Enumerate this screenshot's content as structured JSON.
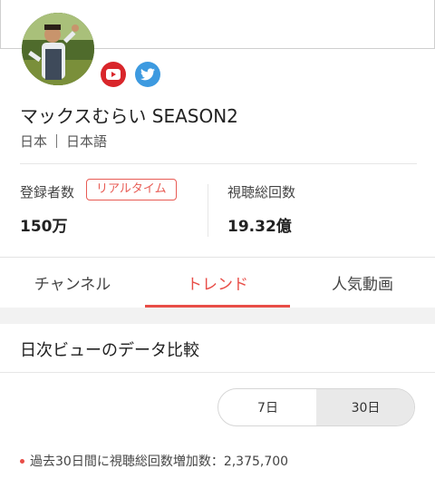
{
  "channel": {
    "name": "マックスむらい SEASON2",
    "country": "日本",
    "language": "日本語",
    "avatar_icon": "channel-avatar-photo",
    "social": [
      {
        "icon": "youtube-icon",
        "color": "#d9262b"
      },
      {
        "icon": "twitter-icon",
        "color": "#3d9ae0"
      }
    ]
  },
  "stats": {
    "subscribers_label": "登録者数",
    "realtime_badge": "リアルタイム",
    "subscribers_value": "150万",
    "views_label": "視聴総回数",
    "views_value": "19.32億"
  },
  "tabs": [
    {
      "label": "チャンネル",
      "active": false
    },
    {
      "label": "トレンド",
      "active": true
    },
    {
      "label": "人気動画",
      "active": false
    }
  ],
  "section": {
    "title": "日次ビューのデータ比較",
    "range_options": [
      {
        "label": "7日",
        "selected": false
      },
      {
        "label": "30日",
        "selected": true
      }
    ],
    "note": "過去30日間に視聴総回数増加数：2,375,700"
  },
  "colors": {
    "accent": "#e84d47",
    "badge": "#e85b54"
  }
}
